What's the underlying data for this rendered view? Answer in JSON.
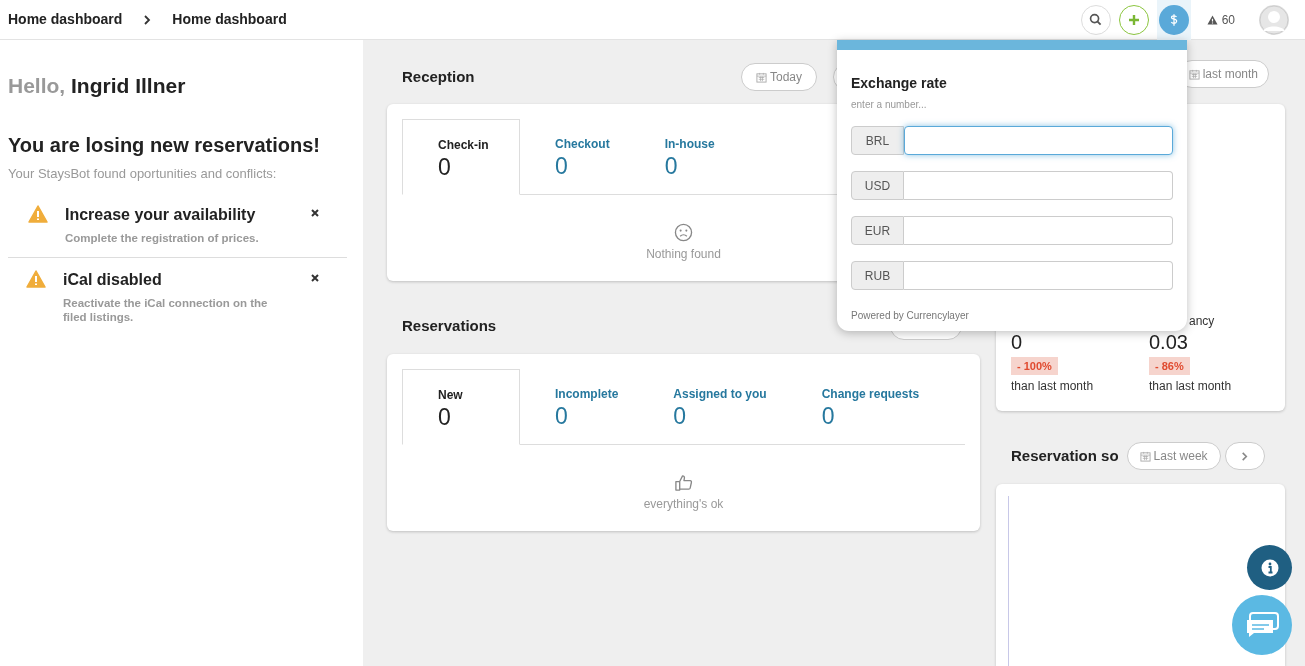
{
  "breadcrumbs": [
    "Home dashboard",
    "Home dashboard"
  ],
  "top_bar": {
    "alerts_count": "60",
    "currency_open": true
  },
  "sidebar": {
    "greeting": "Hello,",
    "user_name": "Ingrid Illner",
    "headline": "You are losing new reservations!",
    "subtitle": "Your StaysBot found oportunities and conflicts:",
    "alerts": [
      {
        "title": "Increase your availability",
        "description": "Complete the registration of prices."
      },
      {
        "title": "iCal disabled",
        "description": "Reactivate the iCal connection on the filed listings."
      }
    ]
  },
  "reception": {
    "title": "Reception",
    "period": "Today",
    "tabs": [
      {
        "label": "Check-in",
        "count": "0",
        "selected": true
      },
      {
        "label": "Checkout",
        "count": "0",
        "selected": false
      },
      {
        "label": "In-house",
        "count": "0",
        "selected": false
      }
    ],
    "empty_message": "Nothing found"
  },
  "reservations": {
    "title": "Reservations",
    "tabs": [
      {
        "label": "New",
        "count": "0",
        "selected": true
      },
      {
        "label": "Incomplete",
        "count": "0",
        "selected": false
      },
      {
        "label": "Assigned to you",
        "count": "0",
        "selected": false
      },
      {
        "label": "Change requests",
        "count": "0",
        "selected": false
      }
    ],
    "empty_message": "everything's ok"
  },
  "stats": {
    "period": "last month",
    "label_fragment": "ancy",
    "metrics": [
      {
        "value": "0",
        "change": "- 100%",
        "caption": "than last month"
      },
      {
        "value": "0.03",
        "change": "- 86%",
        "caption": "than last month"
      }
    ]
  },
  "reservation_sources": {
    "title": "Reservation so",
    "period": "Last week"
  },
  "exchange_popover": {
    "title": "Exchange rate",
    "hint": "enter a number...",
    "currencies": [
      {
        "code": "BRL",
        "focused": true
      },
      {
        "code": "USD",
        "focused": false
      },
      {
        "code": "EUR",
        "focused": false
      },
      {
        "code": "RUB",
        "focused": false
      }
    ],
    "footer": "Powered by Currencylayer"
  }
}
